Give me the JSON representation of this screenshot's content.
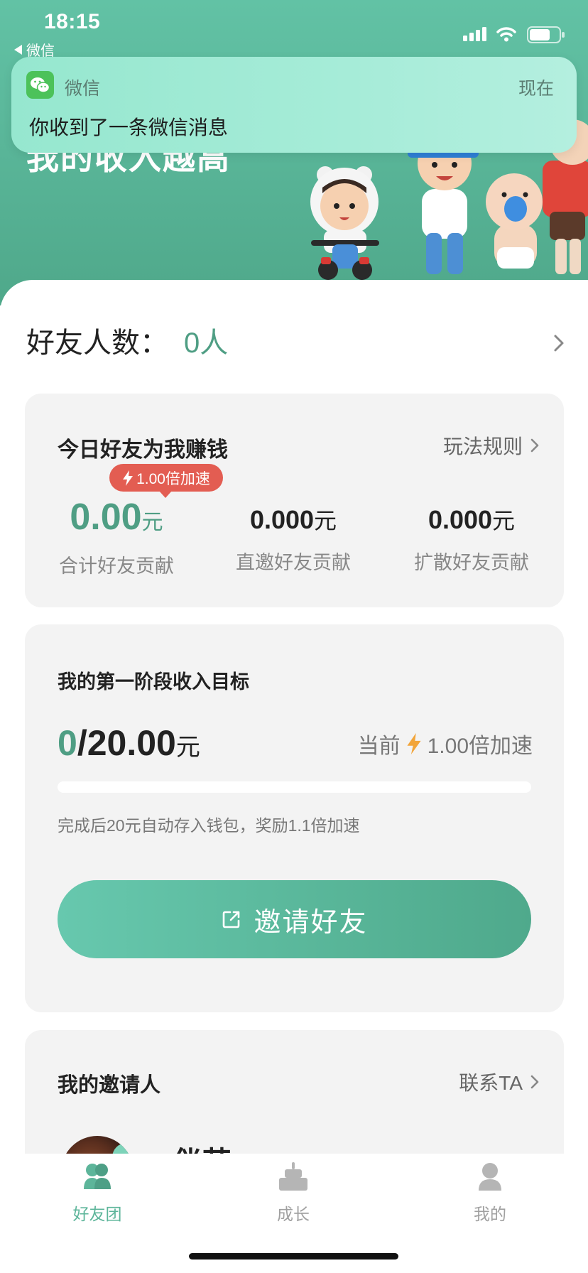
{
  "status_bar": {
    "time": "18:15",
    "back_label": "微信",
    "icons": [
      "back-arrow-icon",
      "signal-icon",
      "wifi-icon",
      "battery-icon"
    ]
  },
  "notification": {
    "icon": "wechat-icon",
    "app": "微信",
    "time": "现在",
    "message": "你收到了一条微信消息"
  },
  "header": {
    "title": "我的收入越高"
  },
  "friends_count": {
    "label": "好友人数：",
    "value": "0人"
  },
  "today_card": {
    "title": "今日好友为我赚钱",
    "rules_link": "玩法规则",
    "badge": "1.00倍加速",
    "stats": [
      {
        "value": "0.00",
        "unit": "元",
        "label": "合计好友贡献"
      },
      {
        "value": "0.000",
        "unit": "元",
        "label": "直邀好友贡献"
      },
      {
        "value": "0.000",
        "unit": "元",
        "label": "扩散好友贡献"
      }
    ]
  },
  "goal_card": {
    "title": "我的第一阶段收入目标",
    "current": "0",
    "target": "/20.00",
    "unit": "元",
    "speed_prefix": "当前",
    "speed_value": "1.00倍加速",
    "progress": 0,
    "note": "完成后20元自动存入钱包，奖励1.1倍加速",
    "invite_button": "邀请好友"
  },
  "inviter_card": {
    "title": "我的邀请人",
    "contact": "联系TA",
    "name": "□伴芸□"
  },
  "tabbar": {
    "items": [
      {
        "label": "好友团",
        "icon": "friends-group-icon",
        "active": true
      },
      {
        "label": "成长",
        "icon": "growth-icon",
        "active": false
      },
      {
        "label": "我的",
        "icon": "profile-icon",
        "active": false
      }
    ]
  },
  "colors": {
    "accent": "#4f9e84",
    "badge": "#e35d52",
    "bolt": "#f2a53a",
    "card": "#f3f3f3"
  }
}
